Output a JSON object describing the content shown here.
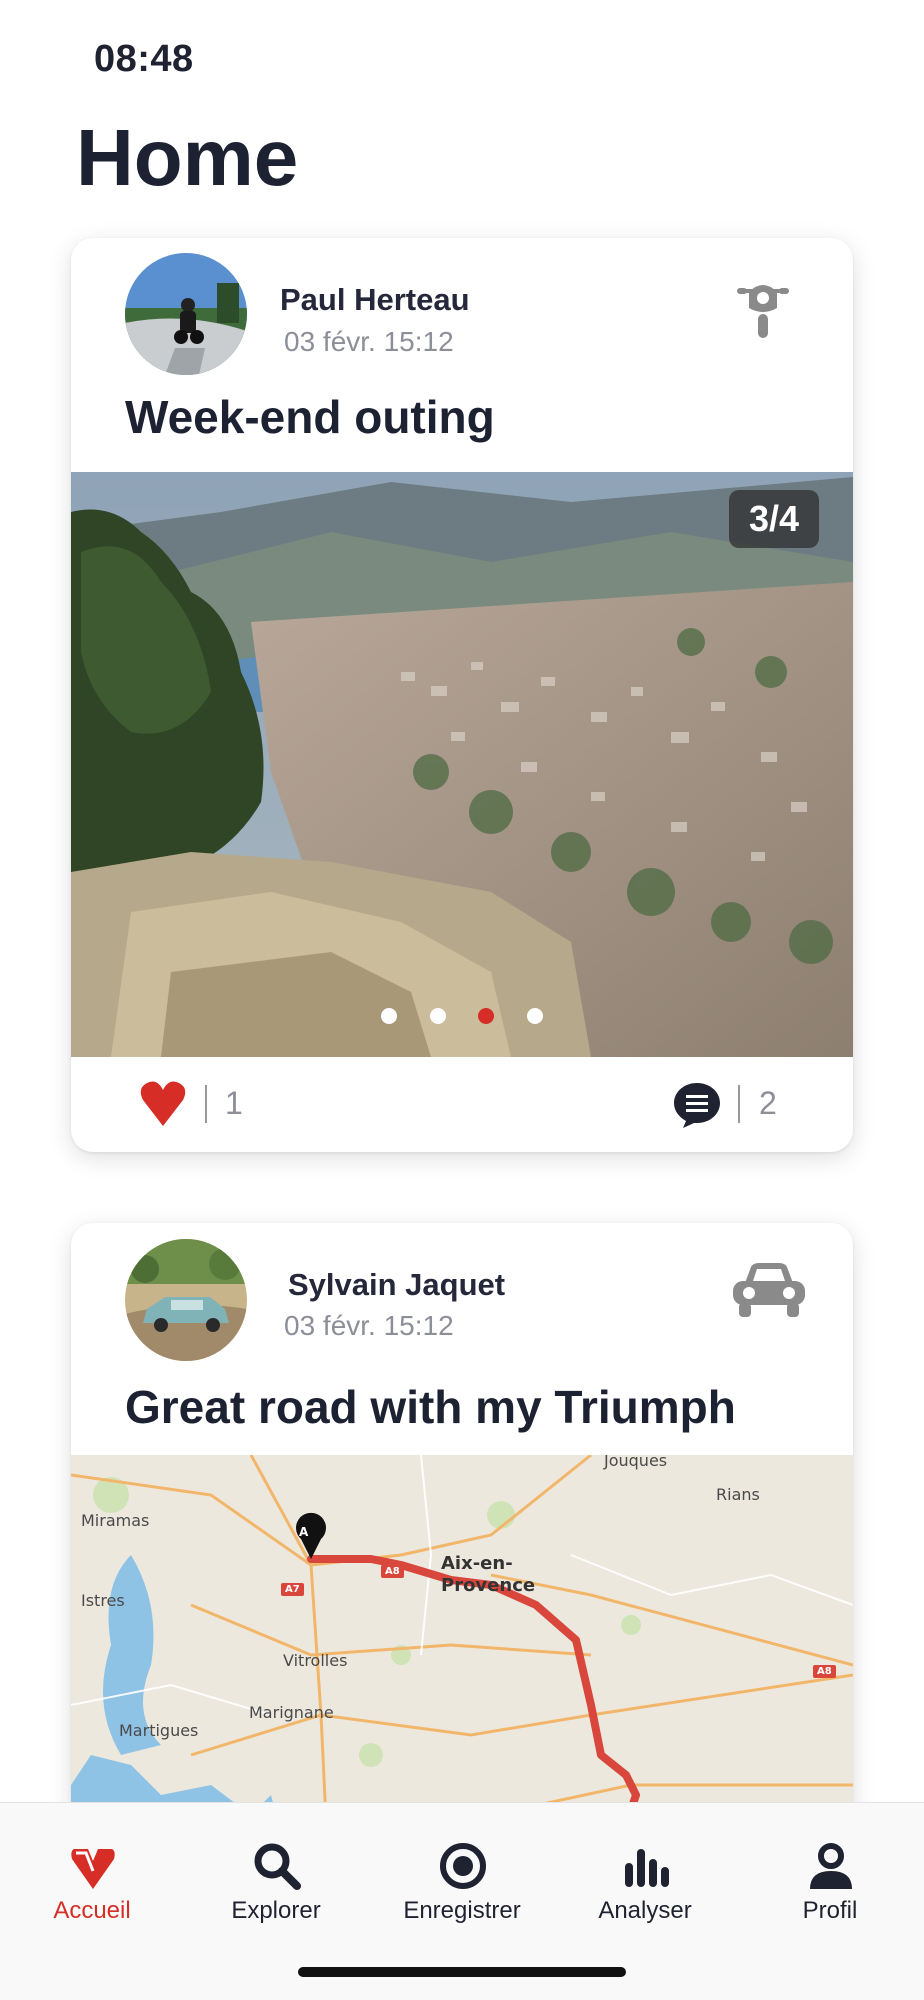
{
  "status": {
    "time": "08:48"
  },
  "header": {
    "title": "Home"
  },
  "colors": {
    "accent": "#d62e26",
    "text": "#1d2233",
    "muted": "#8c8f98",
    "route": "#d8463c"
  },
  "posts": [
    {
      "author": "Paul Herteau",
      "date": "03 févr. 15:12",
      "vehicle_icon": "motorcycle-icon",
      "title": "Week-end outing",
      "photo_counter": "3/4",
      "photo_index": 3,
      "photo_total": 4,
      "likes": "1",
      "comments": "2"
    },
    {
      "author": "Sylvain Jaquet",
      "date": "03 févr. 15:12",
      "vehicle_icon": "car-icon",
      "title": "Great road with my Triumph",
      "map": {
        "start_marker": "A",
        "places": [
          "Jouques",
          "Rians",
          "Miramas",
          "Istres",
          "Aix-en-Provence",
          "Vitrolles",
          "Marignane",
          "Martigues"
        ],
        "roads": [
          "A7",
          "A8",
          "A8"
        ]
      }
    }
  ],
  "tabs": [
    {
      "label": "Accueil",
      "icon": "home-pin-icon",
      "active": true
    },
    {
      "label": "Explorer",
      "icon": "search-icon",
      "active": false
    },
    {
      "label": "Enregistrer",
      "icon": "record-icon",
      "active": false
    },
    {
      "label": "Analyser",
      "icon": "bar-chart-icon",
      "active": false
    },
    {
      "label": "Profil",
      "icon": "profile-icon",
      "active": false
    }
  ]
}
